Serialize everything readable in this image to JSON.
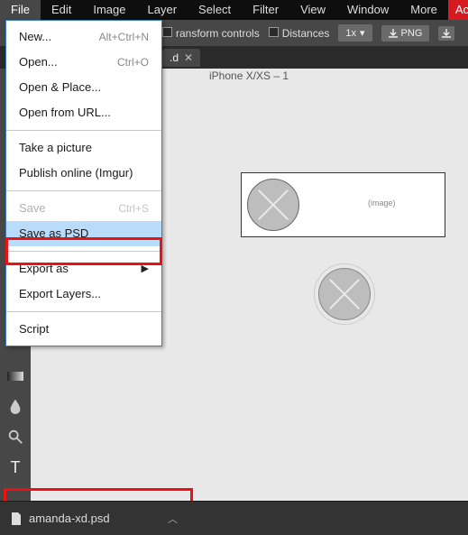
{
  "menubar": {
    "items": [
      "File",
      "Edit",
      "Image",
      "Layer",
      "Select",
      "Filter",
      "View",
      "Window",
      "More"
    ],
    "account": "Account"
  },
  "toolbar": {
    "transform_label": "ransform controls",
    "distances_label": "Distances",
    "zoom_level": "1x",
    "png_label": "PNG"
  },
  "tabbar": {
    "tab_label": ".d"
  },
  "file_menu": {
    "new": {
      "label": "New...",
      "shortcut": "Alt+Ctrl+N"
    },
    "open": {
      "label": "Open...",
      "shortcut": "Ctrl+O"
    },
    "open_place": {
      "label": "Open & Place..."
    },
    "open_url": {
      "label": "Open from URL..."
    },
    "take_picture": {
      "label": "Take a picture"
    },
    "publish": {
      "label": "Publish online (Imgur)"
    },
    "save": {
      "label": "Save",
      "shortcut": "Ctrl+S"
    },
    "save_psd": {
      "label": "Save as PSD"
    },
    "export_as": {
      "label": "Export as"
    },
    "export_layers": {
      "label": "Export Layers..."
    },
    "script": {
      "label": "Script"
    }
  },
  "canvas": {
    "artboard_name": "iPhone X/XS – 1",
    "placeholder_text": "(image)"
  },
  "statusbar": {
    "filename": "amanda-xd.psd"
  }
}
